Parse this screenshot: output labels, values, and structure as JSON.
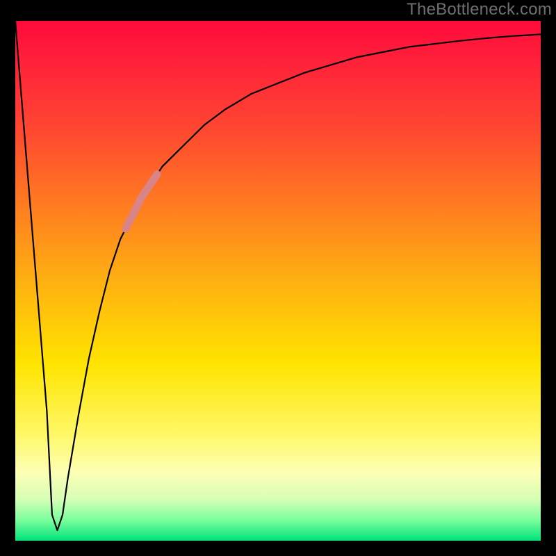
{
  "watermark": "TheBottleneck.com",
  "chart_data": {
    "type": "line",
    "title": "",
    "xlabel": "",
    "ylabel": "",
    "xlim": [
      0,
      100
    ],
    "ylim": [
      0,
      100
    ],
    "grid": false,
    "legend": false,
    "series": [
      {
        "name": "bottleneck-curve",
        "x": [
          0,
          2,
          4,
          6,
          7,
          8,
          9,
          10,
          12,
          14,
          16,
          18,
          20,
          24,
          28,
          32,
          36,
          40,
          45,
          50,
          55,
          60,
          65,
          70,
          75,
          80,
          85,
          90,
          95,
          100
        ],
        "values": [
          100,
          75,
          50,
          25,
          5,
          2,
          5,
          12,
          24,
          35,
          44,
          52,
          58,
          66,
          72,
          76,
          80,
          83,
          86,
          88,
          90,
          91.5,
          93,
          94,
          95,
          95.6,
          96.2,
          96.7,
          97.1,
          97.4
        ]
      }
    ],
    "highlight_segment": {
      "name": "marker",
      "series": "bottleneck-curve",
      "x_start": 21,
      "x_end": 27,
      "color": "#d98487"
    },
    "gradient_stops": [
      {
        "pos": 0.0,
        "color": "#ff0a3b"
      },
      {
        "pos": 0.2,
        "color": "#ff4432"
      },
      {
        "pos": 0.35,
        "color": "#ff7a21"
      },
      {
        "pos": 0.5,
        "color": "#ffb011"
      },
      {
        "pos": 0.66,
        "color": "#ffe400"
      },
      {
        "pos": 0.87,
        "color": "#fdffb6"
      },
      {
        "pos": 0.96,
        "color": "#7bff9d"
      },
      {
        "pos": 1.0,
        "color": "#00e27a"
      }
    ]
  }
}
